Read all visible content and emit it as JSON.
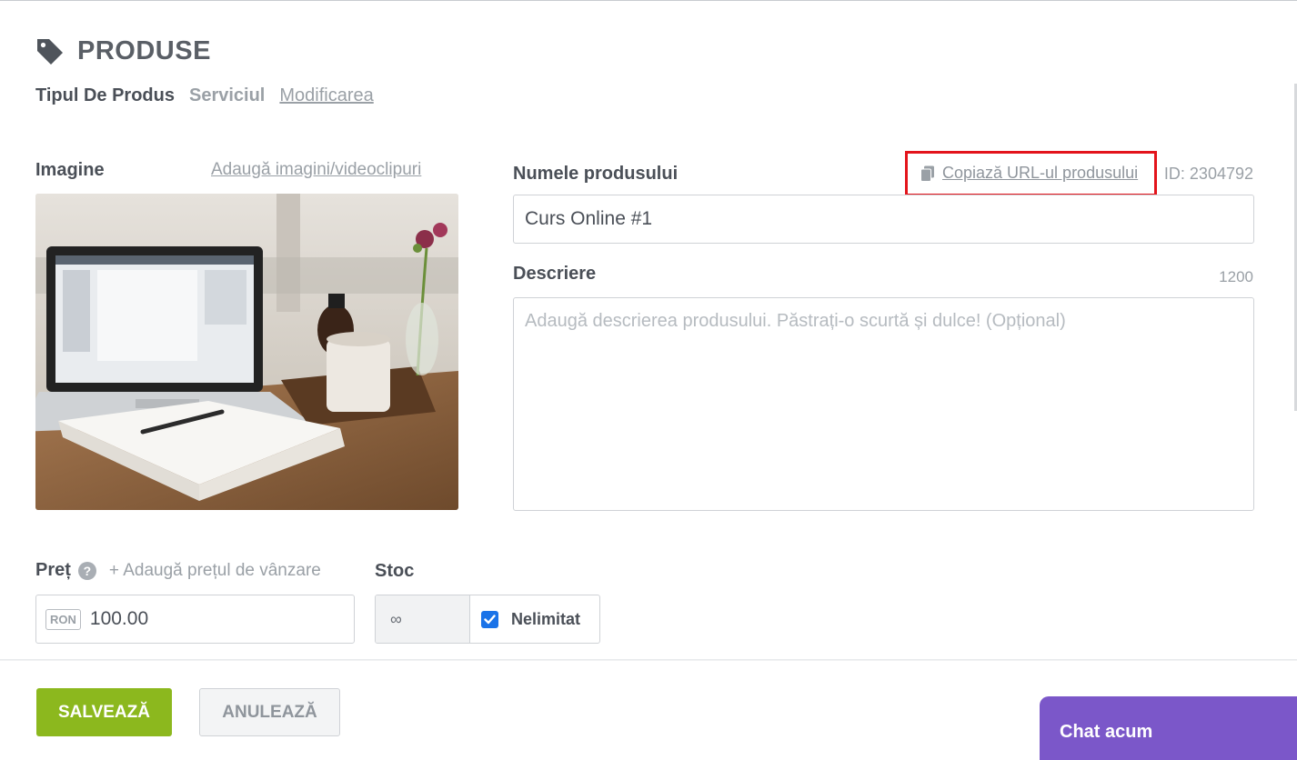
{
  "header": {
    "title": "PRODUSE",
    "icon": "tag-icon"
  },
  "breadcrumb": {
    "type_label": "Tipul De Produs",
    "type_value": "Serviciul",
    "edit_link": "Modificarea"
  },
  "image": {
    "label": "Imagine",
    "add_link": "Adaugă imagini/videoclipuri"
  },
  "product_name": {
    "label": "Numele produsului",
    "copy_url_link": "Copiază URL-ul produsului",
    "id_text": "ID: 2304792",
    "value": "Curs Online #1"
  },
  "description": {
    "label": "Descriere",
    "char_count": "1200",
    "placeholder": "Adaugă descrierea produsului. Păstrați-o scurtă și dulce! (Opțional)",
    "value": ""
  },
  "price": {
    "label": "Preț",
    "add_sale_link": "+ Adaugă prețul de vânzare",
    "currency": "RON",
    "value": "100.00"
  },
  "stock": {
    "label": "Stoc",
    "value": "∞",
    "unlimited_label": "Nelimitat",
    "unlimited_checked": true
  },
  "actions": {
    "save": "SALVEAZĂ",
    "cancel": "ANULEAZĂ"
  },
  "chat": {
    "label": "Chat acum"
  },
  "colors": {
    "save_button": "#8cb81e",
    "chat_widget": "#7b57c9",
    "highlight_box": "#e3141b",
    "checkbox": "#1a73e8"
  }
}
